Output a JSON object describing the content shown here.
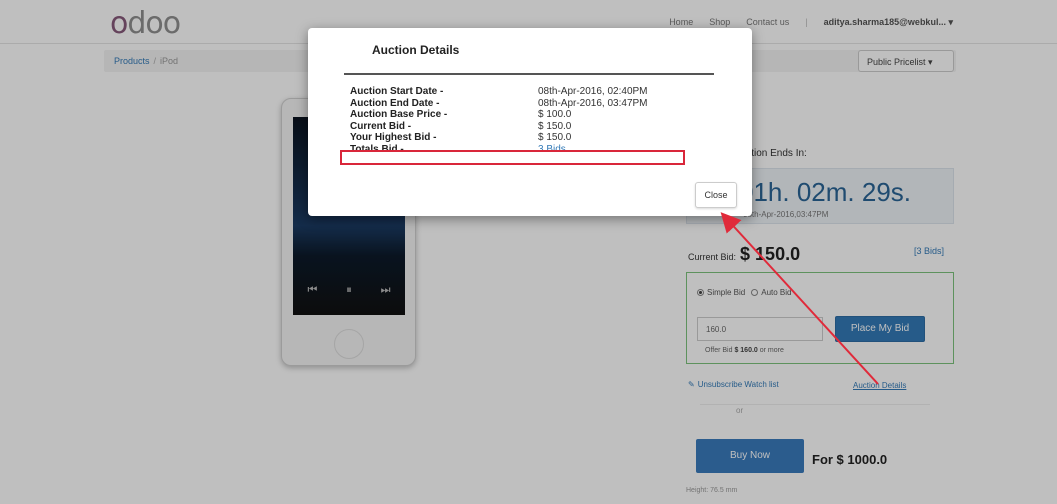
{
  "header": {
    "logo_first": "o",
    "logo_rest": "doo",
    "nav": [
      "Home",
      "Shop",
      "Contact us"
    ],
    "user": "aditya.sharma185@webkul..."
  },
  "breadcrumb": {
    "parent": "Products",
    "current": "iPod"
  },
  "pricelist": "Public Pricelist",
  "auction": {
    "ends_label": "Auction Ends In:",
    "countdown_prefix": "01",
    "countdown_rest": "h. 02m. 29s.",
    "end_time": "08th-Apr-2016,03:47PM",
    "current_bid_label": "Current Bid:",
    "current_bid": "$ 150.0",
    "bids_link": "[3 Bids]",
    "simple_bid": "Simple Bid",
    "auto_bid": "Auto Bid",
    "bid_input_value": "160.0",
    "place_bid": "Place My Bid",
    "offer_prefix": "Offer Bid",
    "offer_amount": "$ 160.0",
    "offer_suffix": "or more",
    "watchlist": "Unsubscribe Watch list",
    "auction_details_link": "Auction Details",
    "or": "or",
    "buy_now": "Buy Now",
    "for_price": "For $ 1000.0",
    "attr_height": "Height: 76.5 mm"
  },
  "modal": {
    "title": "Auction Details",
    "rows": [
      {
        "label": "Auction Start Date -",
        "value": "08th-Apr-2016, 02:40PM"
      },
      {
        "label": "Auction End Date -",
        "value": "08th-Apr-2016, 03:47PM"
      },
      {
        "label": "Auction Base Price -",
        "value": "$ 100.0"
      },
      {
        "label": "Current Bid -",
        "value": "$ 150.0"
      },
      {
        "label": "Your Highest Bid -",
        "value": "$ 150.0"
      },
      {
        "label": "Totals Bid -",
        "value": "3 Bids"
      }
    ],
    "close_label": "Close"
  },
  "colors": {
    "highlight": "#d9263a",
    "accent": "#337ab7",
    "logo": "#875a7b"
  }
}
